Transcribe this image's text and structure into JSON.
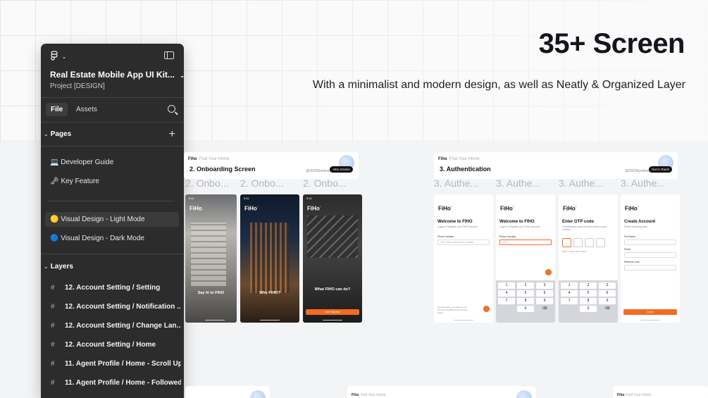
{
  "hero": {
    "title": "35+ Screen",
    "subtitle": "With a minimalist and modern design, as well as Neatly & Organized Layer"
  },
  "panel": {
    "logo_icon": "figma-icon",
    "project_title": "Real Estate Mobile App UI Kit...",
    "project_subtitle": "Project [DESIGN]",
    "tabs": {
      "file": "File",
      "assets": "Assets"
    },
    "pages_header": "Pages",
    "pages": [
      {
        "icon": "laptop-icon",
        "label": "💻 Developer Guide"
      },
      {
        "icon": "key-icon",
        "label": "🗝 Key Feature"
      },
      {
        "icon": "yellow-circle-icon",
        "label": "🟡 Visual Design - Light Mode"
      },
      {
        "icon": "blue-circle-icon",
        "label": "🔵 Visual Design - Dark Mode"
      }
    ],
    "layers_header": "Layers",
    "layers": [
      "12. Account Setting / Setting",
      "12. Account Setting / Notification ...",
      "12. Account Setting / Change Lan...",
      "12. Account Setting / Home",
      "11. Agent Profile / Home - Scroll Up",
      "11. Agent Profile / Home - Followed"
    ]
  },
  "frames": [
    {
      "brand": "Fiho",
      "brand_tag": "Find Your Home",
      "title": "2.   Onboarding Screen",
      "handle": "@2025fiyodesign",
      "pill": "Intro Screen",
      "labels": [
        "2. Onbo...",
        "2. Onbo...",
        "2. Onbo..."
      ],
      "screens": [
        {
          "title": "Say hi to FIHO",
          "status": "9:41"
        },
        {
          "title": "Why FIHO?",
          "status": "9:41"
        },
        {
          "title": "What FIHO can do?",
          "status": "9:41",
          "cta": "Get Started"
        }
      ]
    },
    {
      "brand": "Fiho",
      "brand_tag": "Find Your Home",
      "title": "3.   Authentication",
      "handle": "@2025fiyodesign",
      "pill": "Get in Touch",
      "labels": [
        "3. Authe...",
        "3. Authe...",
        "3. Authe...",
        "3. Authe..."
      ],
      "screens": [
        {
          "title": "Welcome to FIHO",
          "subtitle": "Login or Register your FIHO account",
          "field_label": "Phone Number",
          "placeholder": "Enter your phone number",
          "prefix": "+62",
          "footer": "By continuing, you agree to our Terms & Conditions and Privacy Policy"
        },
        {
          "title": "Welcome to FIHO",
          "subtitle": "Login or Register your FIHO account",
          "field_label": "Phone Number",
          "prefix": "+62"
        },
        {
          "title": "Enter OTP code",
          "subtitle": "A verification code has been sent to your number",
          "resend": "Didn't receive OTP code?"
        },
        {
          "title": "Create Account",
          "subtitle": "Fill the following data",
          "fields": [
            "Full Name",
            "Email",
            "Referral Code"
          ],
          "cta": "Done"
        }
      ]
    }
  ],
  "keypad": [
    "1",
    "2",
    "3",
    "4",
    "5",
    "6",
    "7",
    "8",
    "9",
    "",
    "0",
    "⌫"
  ],
  "bottom_frames": [
    {
      "brand": "Fiho",
      "brand_tag": "Find Your Home"
    },
    {
      "brand": "Fiho",
      "brand_tag": "Find Your Home"
    },
    {
      "brand": "Fiho",
      "brand_tag": "Find Your Home"
    }
  ],
  "colors": {
    "accent": "#f36c21",
    "panel_bg": "#2c2c2c",
    "title": "#14161c"
  }
}
